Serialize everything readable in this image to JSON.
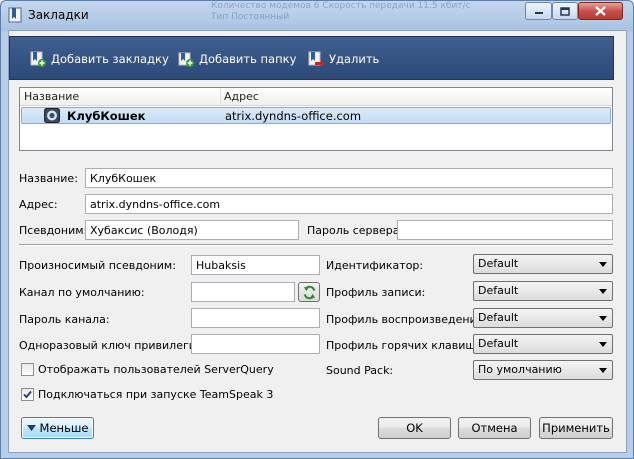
{
  "window": {
    "title": "Закладки",
    "background_text": [
      "Количество модемов    6 Скорость передачи 11.5 кбит/с",
      "Тип                  Постоянный"
    ]
  },
  "toolbar": {
    "add_bookmark": "Добавить закладку",
    "add_folder": "Добавить папку",
    "delete": "Удалить"
  },
  "list": {
    "columns": [
      "Название",
      "Адрес"
    ],
    "rows": [
      {
        "name": "КлубКошек",
        "address": "atrix.dyndns-office.com"
      }
    ]
  },
  "form": {
    "name_label": "Название:",
    "name_value": "КлубКошек",
    "address_label": "Адрес:",
    "address_value": "atrix.dyndns-office.com",
    "nickname_label": "Псевдоним:",
    "nickname_value": "Хубаксис (Володя)",
    "server_password_label": "Пароль сервера:",
    "server_password_value": ""
  },
  "advanced": {
    "phonetic_label": "Произносимый псевдоним:",
    "phonetic_value": "Hubaksis",
    "default_channel_label": "Канал по умолчанию:",
    "default_channel_value": "",
    "channel_password_label": "Пароль канала:",
    "channel_password_value": "",
    "privilege_key_label": "Одноразовый ключ привилегий:",
    "privilege_key_value": "",
    "show_serverquery_label": "Отображать пользователей ServerQuery",
    "show_serverquery_checked": false,
    "connect_on_start_label": "Подключаться при запуске TeamSpeak 3",
    "connect_on_start_checked": true,
    "identity_label": "Идентификатор:",
    "identity_value": "Default",
    "capture_label": "Профиль записи:",
    "capture_value": "Default",
    "playback_label": "Профиль воспроизведения:",
    "playback_value": "Default",
    "hotkey_label": "Профиль горячих клавиш:",
    "hotkey_value": "Default",
    "soundpack_label": "Sound Pack:",
    "soundpack_value": "По умолчанию"
  },
  "buttons": {
    "less": "Меньше",
    "ok": "OK",
    "cancel": "Отмена",
    "apply": "Применить"
  }
}
